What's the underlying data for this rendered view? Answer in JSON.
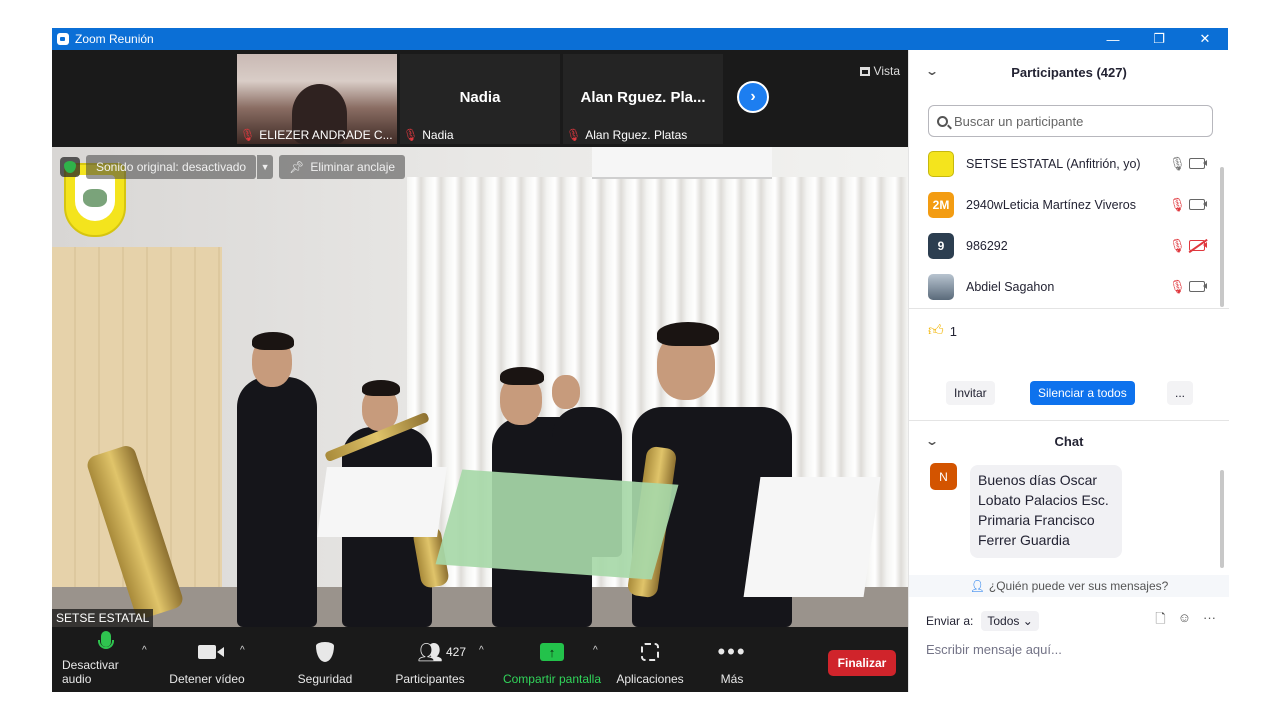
{
  "window": {
    "title": "Zoom Reunión",
    "controls": [
      "—",
      "❐",
      "✕"
    ]
  },
  "thumbnails": [
    {
      "name": "ELIEZER ANDRADE C...",
      "video": true,
      "muted": true
    },
    {
      "name": "Nadia",
      "center_label": "Nadia",
      "video": false,
      "muted": true
    },
    {
      "name": "Alan  Rguez. Platas",
      "center_label": "Alan  Rguez. Pla...",
      "video": false,
      "muted": true
    }
  ],
  "view_button": "Vista",
  "main_video": {
    "original_sound": "Sonido original: desactivado",
    "unpin": "Eliminar anclaje",
    "caption": "SETSE ESTATAL"
  },
  "toolbar": {
    "mute_audio": "Desactivar audio",
    "stop_video": "Detener vídeo",
    "security": "Seguridad",
    "participants": "Participantes",
    "participant_count": "427",
    "share_screen": "Compartir pantalla",
    "apps": "Aplicaciones",
    "more": "Más",
    "end": "Finalizar"
  },
  "participants_panel": {
    "title": "Participantes (427)",
    "search_placeholder": "Buscar un participante",
    "participants": [
      {
        "name": "SETSE ESTATAL (Anfitrión, yo)",
        "avatar": "",
        "avatar_color": "#f4e41d",
        "mic": "on",
        "camera": "on"
      },
      {
        "name": "2940wLeticia Martínez Viveros",
        "avatar": "2M",
        "avatar_color": "#f39c12",
        "mic": "muted",
        "camera": "on"
      },
      {
        "name": "986292",
        "avatar": "9",
        "avatar_color": "#2c3e50",
        "mic": "muted",
        "camera": "off"
      },
      {
        "name": "Abdiel Sagahon",
        "avatar": "",
        "avatar_color": "#7a8a9a",
        "mic": "muted",
        "camera": "on"
      }
    ],
    "reaction_count": "1",
    "invite": "Invitar",
    "mute_all": "Silenciar a todos",
    "more": "..."
  },
  "chat": {
    "title": "Chat",
    "message": {
      "avatar": "N",
      "text_lines": [
        "Buenos días Oscar",
        "Lobato Palacios Esc.",
        "Primaria Francisco",
        "Ferrer Guardia"
      ]
    },
    "who_can_see": "¿Quién puede ver sus mensajes?",
    "send_to_label": "Enviar a:",
    "send_to_value": "Todos",
    "compose_placeholder": "Escribir mensaje aquí..."
  }
}
